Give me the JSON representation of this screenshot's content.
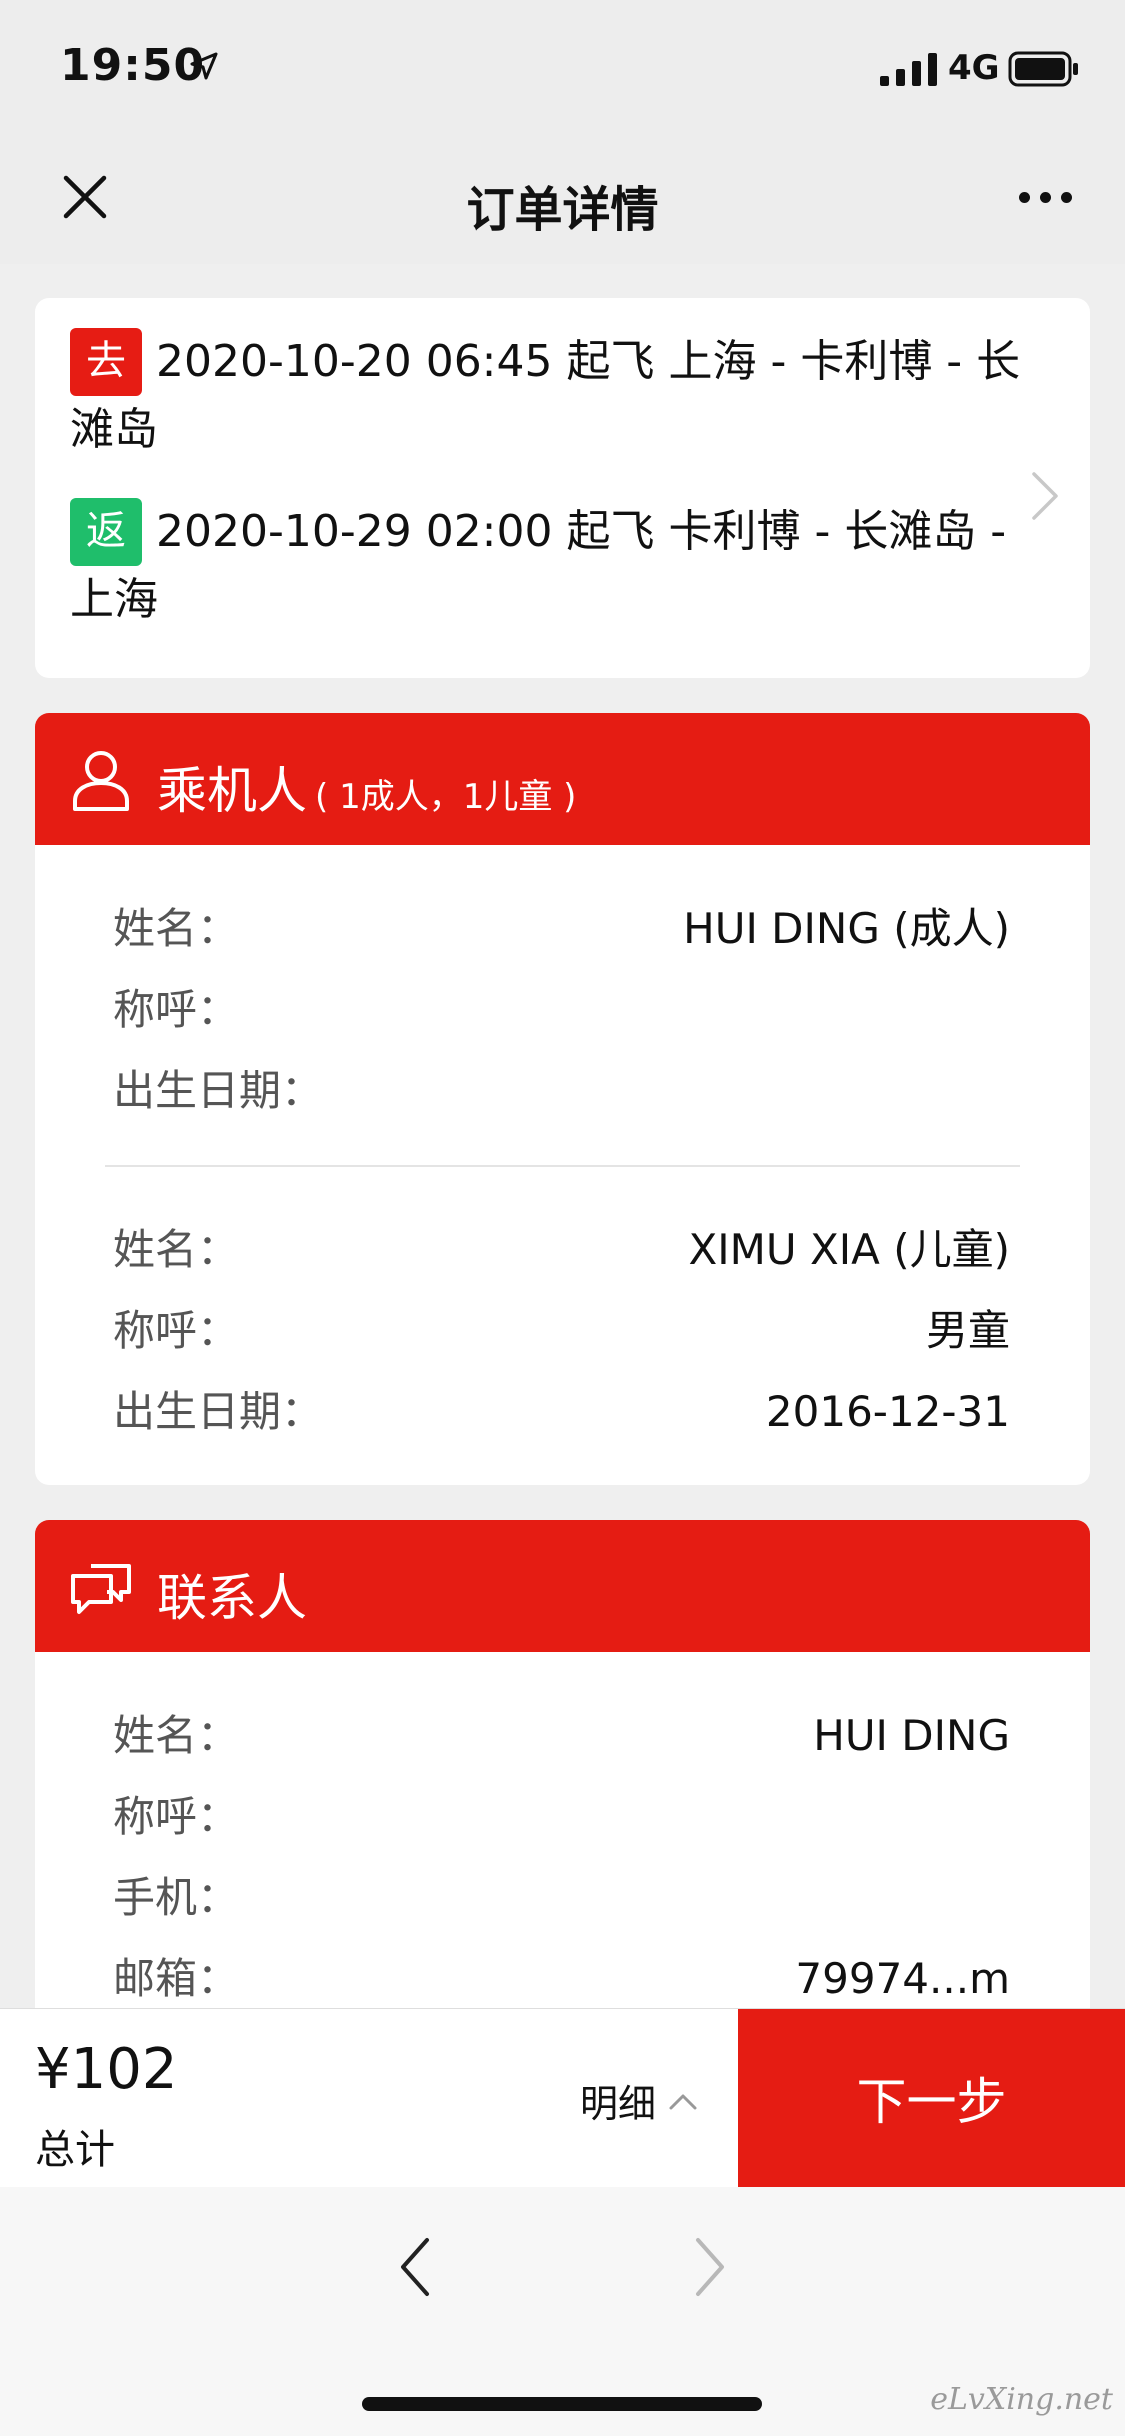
{
  "status_bar": {
    "time": "19:50",
    "network": "4G"
  },
  "nav": {
    "title": "订单详情"
  },
  "flights": {
    "outbound": {
      "badge": "去",
      "text": "2020-10-20 06:45 起飞 上海 - 卡利博 - 长滩岛"
    },
    "return": {
      "badge": "返",
      "text": "2020-10-29 02:00 起飞 卡利博 - 长滩岛 - 上海"
    }
  },
  "passengers": {
    "title": "乘机人",
    "subtitle": "( 1成人，1儿童 )",
    "list": [
      {
        "name_label": "姓名：",
        "name_value": "HUI DING (成人)",
        "salutation_label": "称呼：",
        "salutation_value": "",
        "birth_label": "出生日期：",
        "birth_value": ""
      },
      {
        "name_label": "姓名：",
        "name_value": "XIMU XIA (儿童)",
        "salutation_label": "称呼：",
        "salutation_value": "男童",
        "birth_label": "出生日期：",
        "birth_value": "2016-12-31"
      }
    ]
  },
  "contact": {
    "title": "联系人",
    "name_label": "姓名：",
    "name_value": "HUI DING",
    "salutation_label": "称呼：",
    "salutation_value": "",
    "phone_label": "手机：",
    "phone_value": "",
    "email_label": "邮箱：",
    "email_value": "79974...m"
  },
  "bottom_bar": {
    "price": "¥102",
    "total_label": "总计",
    "detail_label": "明细",
    "next_label": "下一步"
  },
  "watermark": "eLvXing.net",
  "colors": {
    "accent_red": "#e51c13",
    "badge_red": "#e61c14",
    "badge_green": "#1fbe6b"
  }
}
